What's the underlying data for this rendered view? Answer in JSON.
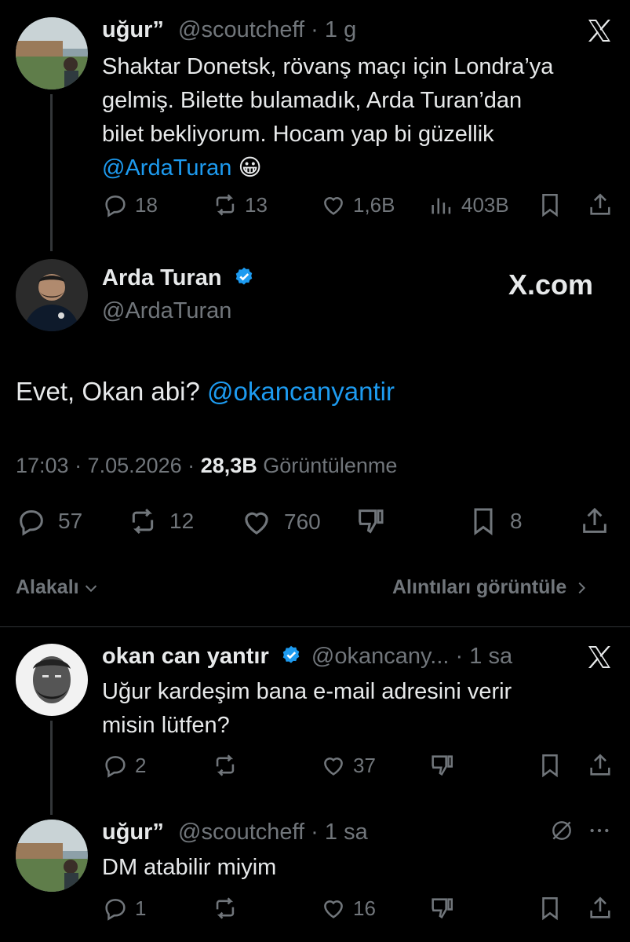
{
  "tweets": [
    {
      "name": "uğur”",
      "handle": "@scoutcheff",
      "time": "· 1 g",
      "text1": "Shaktar Donetsk, rövanş maçı için Londra’ya",
      "text2": "gelmiş. Bilette bulamadık, Arda Turan’dan",
      "text3": "bilet bekliyorum. Hocam yap bi güzellik",
      "mention": "@ArdaTuran",
      "emoji": "😀",
      "replies": "18",
      "retweets": "13",
      "likes": "1,6B",
      "views": "403B"
    },
    {
      "name": "okan can yantır",
      "handle": "@okancany...",
      "time": "· 1 sa",
      "text1": "Uğur kardeşim bana e-mail adresini verir",
      "text2": "misin lütfen?",
      "replies": "2",
      "likes": "37"
    },
    {
      "name": "uğur”",
      "handle": "@scoutcheff",
      "time": "· 1 sa",
      "text1": "DM atabilir miyim",
      "replies": "1",
      "likes": "16"
    }
  ],
  "main": {
    "name": "Arda Turan",
    "handle": "@ArdaTuran",
    "brand": "X.com",
    "text": "Evet, Okan abi?",
    "mention": "@okancanyantir",
    "timestamp": "17:03 · 7.05.2026 ·",
    "views_count": "28,3B",
    "views_label": "Görüntülenme",
    "replies": "57",
    "retweets": "12",
    "likes": "760",
    "bookmarks": "8"
  },
  "filters": {
    "relevance": "Alakalı",
    "quotes": "Alıntıları görüntüle"
  },
  "colors": {
    "accent": "#1d9bf0",
    "muted": "#71767b",
    "text": "#e7e9ea",
    "background": "#000000"
  }
}
